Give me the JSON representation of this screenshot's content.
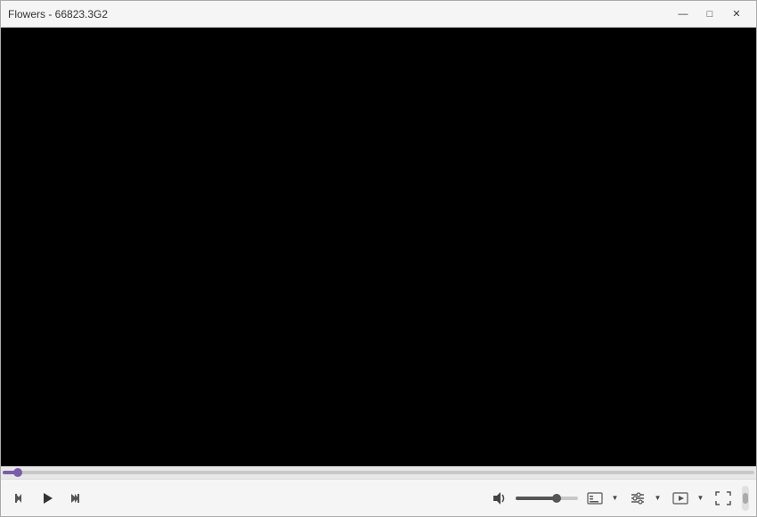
{
  "titleBar": {
    "title": "Flowers - 66823.3G2"
  },
  "windowControls": {
    "minimize": "—",
    "maximize": "□",
    "close": "✕"
  },
  "controls": {
    "prevLabel": "prev",
    "playLabel": "play",
    "nextLabel": "next",
    "volumeLabel": "volume",
    "captionsLabel": "captions",
    "audioLabel": "audio",
    "videoLabel": "video",
    "fullscreenLabel": "fullscreen"
  },
  "progress": {
    "fillPercent": 2
  },
  "volume": {
    "fillPercent": 65
  }
}
